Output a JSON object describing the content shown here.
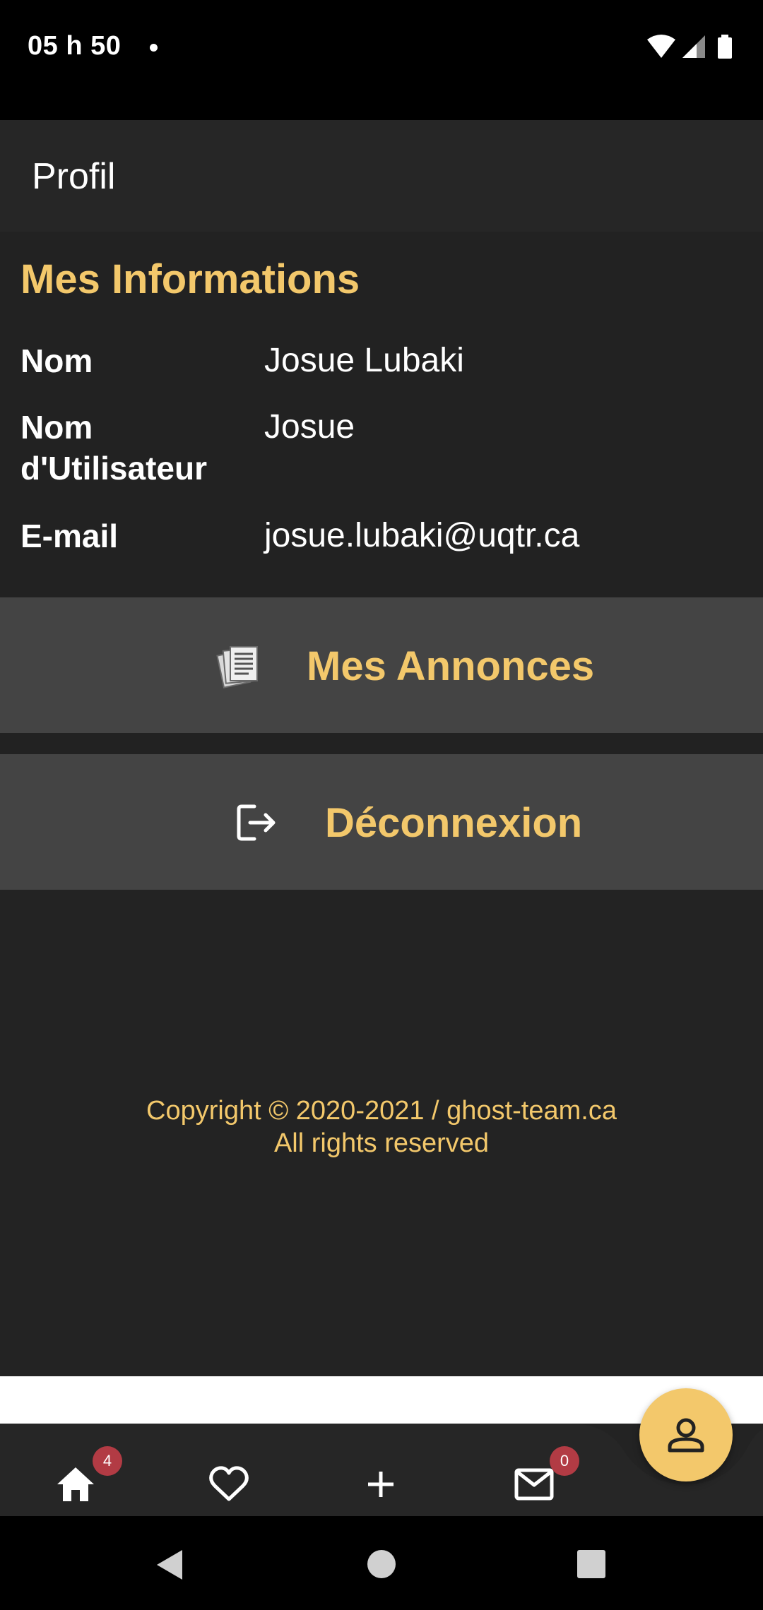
{
  "status_bar": {
    "time": "05 h 50"
  },
  "app_bar": {
    "title": "Profil"
  },
  "info": {
    "section_title": "Mes Informations",
    "fields": [
      {
        "label": "Nom",
        "value": "Josue Lubaki"
      },
      {
        "label": "Nom d'Utilisateur",
        "value": "Josue"
      },
      {
        "label": "E-mail",
        "value": "josue.lubaki@uqtr.ca"
      }
    ]
  },
  "actions": {
    "annonces_label": "Mes Annonces",
    "annonces_icon": "documents-icon",
    "logout_label": "Déconnexion",
    "logout_icon": "logout-icon"
  },
  "footer": {
    "line1": "Copyright © 2020-2021 / ghost-team.ca",
    "line2": "All rights reserved"
  },
  "bottom_nav": {
    "home_badge": "4",
    "messages_badge": "0",
    "items": [
      "home-icon",
      "heart-icon",
      "plus-icon",
      "mail-icon",
      "person-icon"
    ]
  },
  "colors": {
    "accent": "#f3c86b",
    "background": "#232323",
    "button_bg": "#444444",
    "badge": "#b23b44"
  }
}
